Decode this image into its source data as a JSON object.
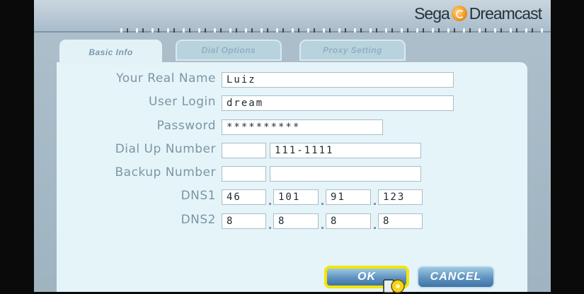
{
  "header": {
    "logo_part1": "Sega",
    "logo_part2": "Dreamcast"
  },
  "tabs": [
    {
      "label": "Basic Info"
    },
    {
      "label": "Dial Options"
    },
    {
      "label": "Proxy Setting"
    }
  ],
  "form": {
    "real_name": {
      "label": "Your Real Name",
      "value": "Luiz"
    },
    "user_login": {
      "label": "User Login",
      "value": "dream"
    },
    "password": {
      "label": "Password",
      "value": "**********"
    },
    "dial_up": {
      "label": "Dial Up Number",
      "area": "",
      "value": "111-1111"
    },
    "backup": {
      "label": "Backup Number",
      "area": "",
      "value": ""
    },
    "dns1": {
      "label": "DNS1",
      "values": [
        "46",
        "101",
        "91",
        "123"
      ]
    },
    "dns2": {
      "label": "DNS2",
      "values": [
        "8",
        "8",
        "8",
        "8"
      ]
    }
  },
  "buttons": {
    "ok": "OK",
    "cancel": "CANCEL"
  },
  "colors": {
    "active_button_border": "#f3e600",
    "button_blue": "#5e93c1"
  }
}
